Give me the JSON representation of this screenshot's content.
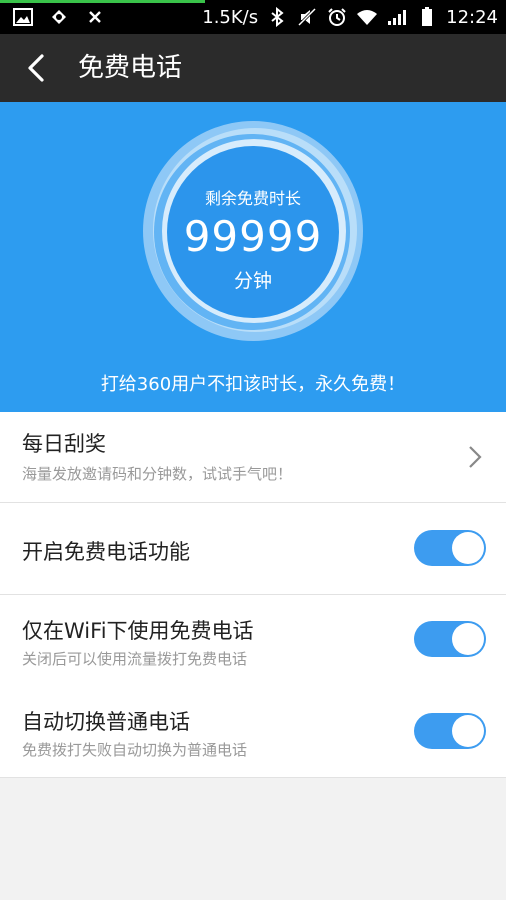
{
  "status_bar": {
    "net_speed": "1.5K/s",
    "time": "12:24",
    "icons": [
      "image-icon",
      "app-icon",
      "close-icon",
      "bluetooth-icon",
      "mute-icon",
      "alarm-icon",
      "wifi-icon",
      "signal-icon",
      "battery-icon"
    ]
  },
  "header": {
    "title": "免费电话",
    "back_icon": "back-arrow-icon"
  },
  "hero": {
    "subtitle": "剩余免费时长",
    "minutes": "99999",
    "unit": "分钟",
    "note": "打给360用户不扣该时长，永久免费！"
  },
  "settings": {
    "daily_lottery": {
      "label": "每日刮奖",
      "desc": "海量发放邀请码和分钟数，试试手气吧！"
    },
    "enable_free_call": {
      "label": "开启免费电话功能",
      "on": true
    },
    "wifi_only": {
      "label": "仅在WiFi下使用免费电话",
      "desc": "关闭后可以使用流量拨打免费电话",
      "on": true
    },
    "auto_switch": {
      "label": "自动切换普通电话",
      "desc": "免费拨打失败自动切换为普通电话",
      "on": true
    }
  },
  "colors": {
    "accent": "#2d9cf0",
    "toggle_on": "#3d9cf0",
    "title_bar": "#2b2b2b",
    "status_bar": "#000000",
    "page_bg": "#f2f2f2"
  }
}
